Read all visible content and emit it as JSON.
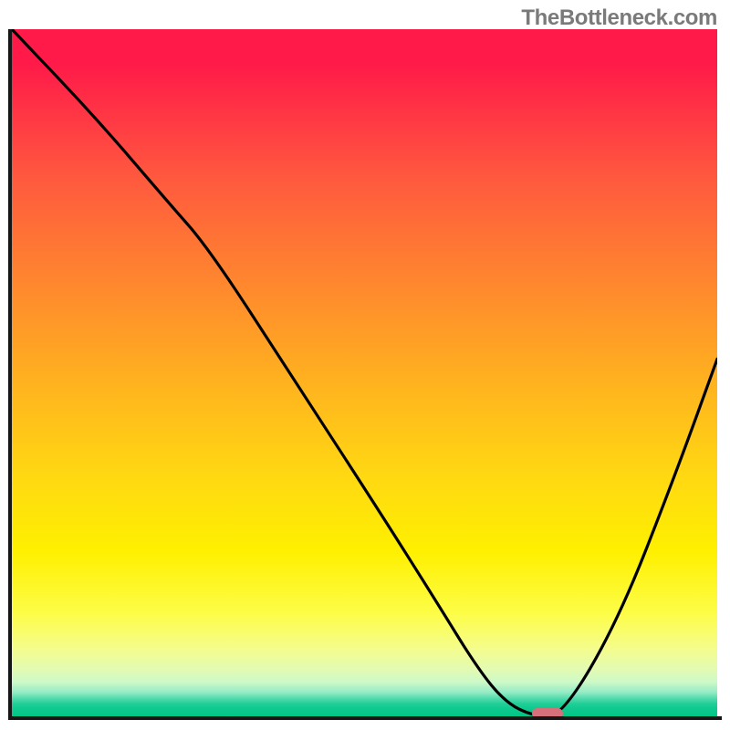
{
  "watermark": "TheBottleneck.com",
  "chart_data": {
    "type": "line",
    "title": "",
    "xlabel": "",
    "ylabel": "",
    "xlim": [
      0,
      100
    ],
    "ylim": [
      0,
      100
    ],
    "legend": null,
    "grid": false,
    "series": [
      {
        "name": "curve",
        "x": [
          0,
          12,
          22,
          28,
          40,
          52,
          60,
          66,
          70,
          74,
          78,
          86,
          94,
          100
        ],
        "y": [
          100,
          87,
          75,
          68,
          49,
          30,
          17,
          7,
          2,
          0,
          0,
          14,
          35,
          52
        ]
      }
    ],
    "marker": {
      "x": 76,
      "y": 0,
      "color": "#d6707b"
    },
    "background_gradient": {
      "top_color": "#ff1a49",
      "bottom_color": "#03c686",
      "description": "vertical red-to-green heatmap gradient"
    }
  }
}
